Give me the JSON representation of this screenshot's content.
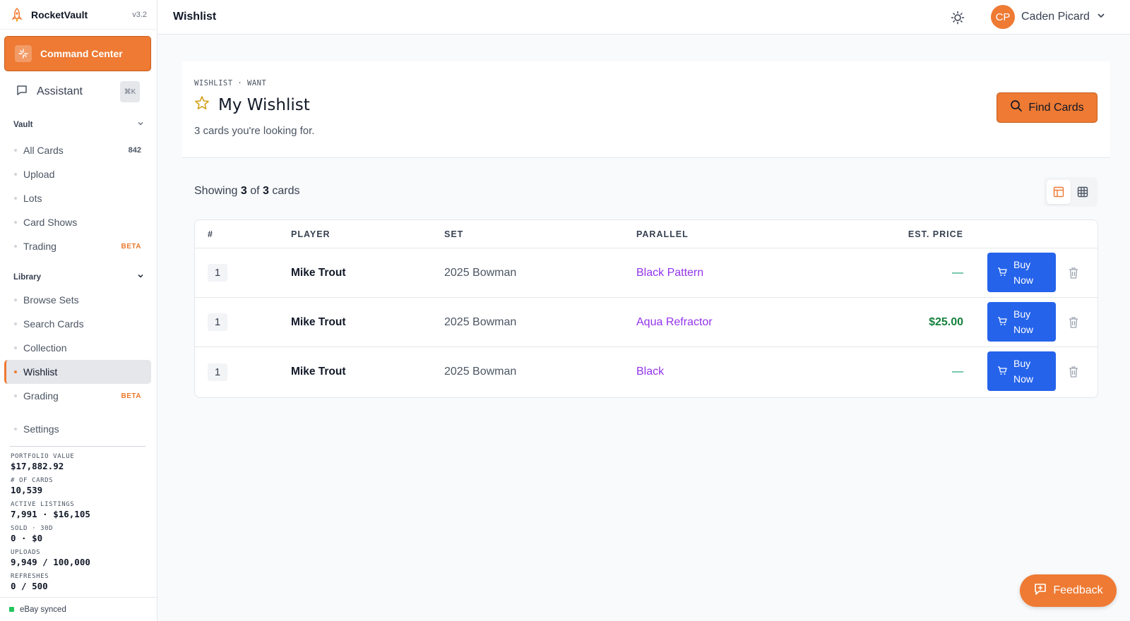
{
  "app": {
    "name": "RocketVault",
    "version": "v3.2"
  },
  "sidebar": {
    "command_center": "Command Center",
    "assistant": {
      "label": "Assistant",
      "shortcut": "⌘K"
    },
    "sections": {
      "vault": "Vault",
      "library": "Library"
    },
    "vault_items": [
      {
        "label": "All Cards",
        "count": "842"
      },
      {
        "label": "Upload"
      },
      {
        "label": "Lots"
      },
      {
        "label": "Card Shows"
      },
      {
        "label": "Trading",
        "badge": "BETA"
      }
    ],
    "library_items": [
      {
        "label": "Browse Sets"
      },
      {
        "label": "Search Cards"
      },
      {
        "label": "Collection"
      },
      {
        "label": "Wishlist",
        "active": true
      },
      {
        "label": "Grading",
        "badge": "BETA"
      }
    ],
    "settings": "Settings",
    "stats": [
      {
        "key": "PORTFOLIO VALUE",
        "value": "$17,882.92"
      },
      {
        "key": "# OF CARDS",
        "value": "10,539"
      },
      {
        "key": "ACTIVE LISTINGS",
        "value": "7,991 · $16,105"
      },
      {
        "key": "SOLD · 30D",
        "value": "0 · $0"
      },
      {
        "key": "UPLOADS",
        "value": "9,949 / 100,000"
      },
      {
        "key": "REFRESHES",
        "value": "0 / 500"
      }
    ],
    "sync_status": "eBay synced"
  },
  "topbar": {
    "title": "Wishlist",
    "user": {
      "initials": "CP",
      "name": "Caden Picard"
    }
  },
  "header": {
    "eyebrow": "WISHLIST · WANT",
    "title": "My Wishlist",
    "subtitle": "3 cards you're looking for.",
    "find_button": "Find Cards"
  },
  "list": {
    "showing_prefix": "Showing",
    "shown": "3",
    "of": "of",
    "total": "3",
    "suffix": "cards"
  },
  "table": {
    "headers": {
      "num": "#",
      "player": "PLAYER",
      "set": "SET",
      "parallel": "PARALLEL",
      "price": "EST. PRICE"
    },
    "rows": [
      {
        "num": "1",
        "player": "Mike Trout",
        "set": "2025 Bowman",
        "parallel": "Black Pattern",
        "price": "—",
        "buy": "Buy Now"
      },
      {
        "num": "1",
        "player": "Mike Trout",
        "set": "2025 Bowman",
        "parallel": "Aqua Refractor",
        "price": "$25.00",
        "buy": "Buy Now"
      },
      {
        "num": "1",
        "player": "Mike Trout",
        "set": "2025 Bowman",
        "parallel": "Black",
        "price": "—",
        "buy": "Buy Now"
      }
    ]
  },
  "feedback_button": "Feedback",
  "colors": {
    "accent": "#ee7a33",
    "primary_blue": "#2563eb",
    "parallel_purple": "#9333ea",
    "price_green": "#15803d"
  }
}
